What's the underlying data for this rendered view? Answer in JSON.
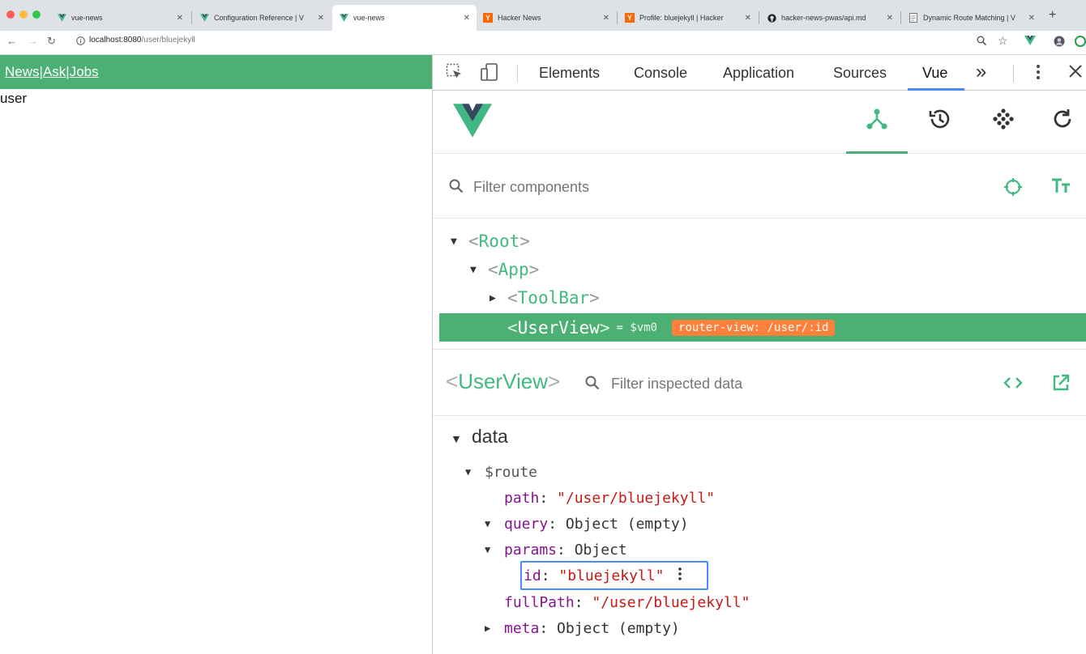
{
  "browser": {
    "tabs": [
      {
        "title": "vue-news",
        "icon": "vue-icon",
        "active": false
      },
      {
        "title": "Configuration Reference | V",
        "icon": "vue-icon",
        "active": false
      },
      {
        "title": "vue-news",
        "icon": "vue-icon",
        "active": true
      },
      {
        "title": "Hacker News",
        "icon": "hn-icon",
        "active": false
      },
      {
        "title": "Profile: bluejekyll | Hacker",
        "icon": "hn-icon",
        "active": false
      },
      {
        "title": "hacker-news-pwas/api.md",
        "icon": "github-icon",
        "active": false
      },
      {
        "title": "Dynamic Route Matching | V",
        "icon": "doc-icon",
        "active": false
      }
    ],
    "url_host": "localhost:8080",
    "url_path": "/user/bluejekyll"
  },
  "page": {
    "nav": {
      "news": "News",
      "ask": "Ask",
      "jobs": "Jobs",
      "sep": "|"
    },
    "body_text": "user"
  },
  "devtools": {
    "tabs": [
      "Elements",
      "Console",
      "Application",
      "Sources",
      "Vue"
    ],
    "active_tab": "Vue",
    "more": "»",
    "accent": "#4a8cf7"
  },
  "vue": {
    "accent": "#42b983",
    "filter_placeholder": "Filter components",
    "tree": {
      "root": "Root",
      "app": "App",
      "toolbar": "ToolBar",
      "userview": "UserView",
      "vm_label": "= $vm0",
      "route_badge": "router-view: /user/:id"
    },
    "inspector": {
      "component": "UserView",
      "filter_placeholder": "Filter inspected data",
      "section": "data",
      "route_key": "$route",
      "path_key": "path",
      "path_val": "\"/user/bluejekyll\"",
      "query_key": "query",
      "query_val": "Object (empty)",
      "params_key": "params",
      "params_val": "Object",
      "id_key": "id",
      "id_val": "\"bluejekyll\"",
      "fullpath_key": "fullPath",
      "fullpath_val": "\"/user/bluejekyll\"",
      "meta_key": "meta",
      "meta_val": "Object (empty)"
    }
  }
}
